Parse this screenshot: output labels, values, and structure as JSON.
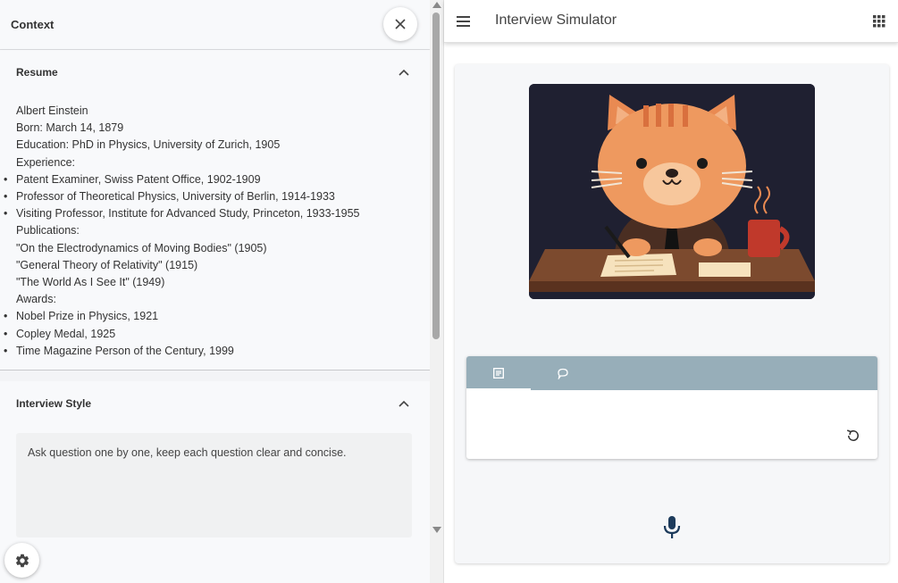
{
  "context": {
    "title": "Context"
  },
  "resume": {
    "title": "Resume",
    "lines": [
      {
        "text": "Albert Einstein",
        "bullet": false
      },
      {
        "text": "Born: March 14, 1879",
        "bullet": false
      },
      {
        "text": "Education: PhD in Physics, University of Zurich, 1905",
        "bullet": false
      },
      {
        "text": "Experience:",
        "bullet": false
      },
      {
        "text": "Patent Examiner, Swiss Patent Office, 1902-1909",
        "bullet": true
      },
      {
        "text": "Professor of Theoretical Physics, University of Berlin, 1914-1933",
        "bullet": true
      },
      {
        "text": "Visiting Professor, Institute for Advanced Study, Princeton, 1933-1955",
        "bullet": true
      },
      {
        "text": "Publications:",
        "bullet": false
      },
      {
        "text": "\"On the Electrodynamics of Moving Bodies\" (1905)",
        "bullet": false
      },
      {
        "text": "\"General Theory of Relativity\" (1915)",
        "bullet": false
      },
      {
        "text": "\"The World As I See It\" (1949)",
        "bullet": false
      },
      {
        "text": "Awards:",
        "bullet": false
      },
      {
        "text": "Nobel Prize in Physics, 1921",
        "bullet": true
      },
      {
        "text": "Copley Medal, 1925",
        "bullet": true
      },
      {
        "text": "Time Magazine Person of the Century, 1999",
        "bullet": true
      }
    ]
  },
  "interview_style": {
    "title": "Interview Style",
    "text": "Ask question one by one, keep each question clear and concise."
  },
  "app": {
    "title": "Interview Simulator"
  },
  "tabs": [
    {
      "icon": "notes-icon",
      "active": true
    },
    {
      "icon": "speech-bubble-icon",
      "active": false
    }
  ],
  "icons": {
    "close": "close-icon",
    "chevron": "chevron-up-icon",
    "settings": "gear-icon",
    "menu": "hamburger-menu-icon",
    "apps": "apps-grid-icon",
    "refresh": "refresh-icon",
    "mic": "microphone-icon",
    "illustration": "cat-interviewer-illustration"
  },
  "colors": {
    "tabbar": "#97aeb9",
    "mic": "#1d3b5c",
    "illustration_bg": "#1f2031"
  }
}
